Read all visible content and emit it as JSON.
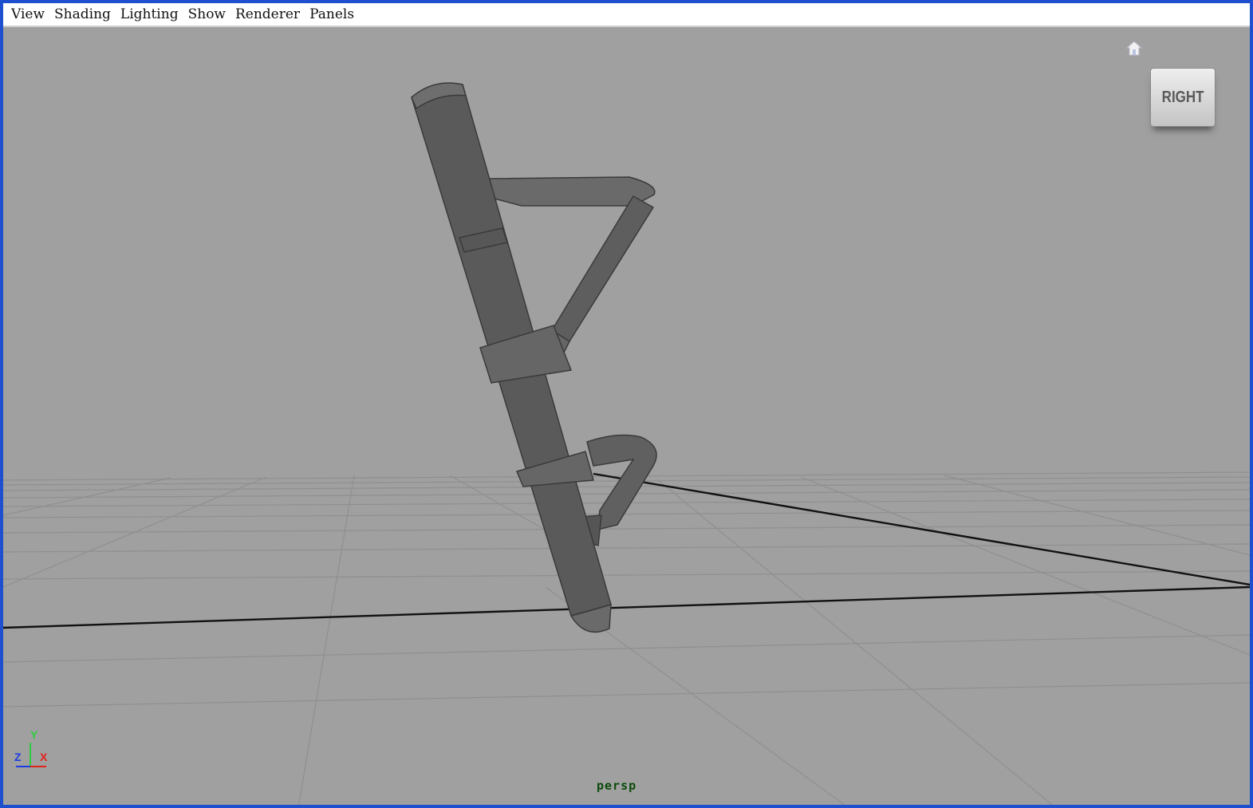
{
  "menubar": {
    "items": [
      "View",
      "Shading",
      "Lighting",
      "Show",
      "Renderer",
      "Panels"
    ]
  },
  "viewport": {
    "camera": "persp",
    "viewcube_face": "RIGHT",
    "axes": {
      "y": "Y",
      "z": "Z",
      "x": "X"
    },
    "icons": [
      "home-icon",
      "viewcube-icon",
      "axis-indicator-icon"
    ]
  },
  "colors": {
    "background": "#a0a0a0",
    "grid": "#8c8c8c",
    "axis_line": "#111111",
    "mesh": "#5a5a5a",
    "window_border": "#1d4fcf"
  }
}
